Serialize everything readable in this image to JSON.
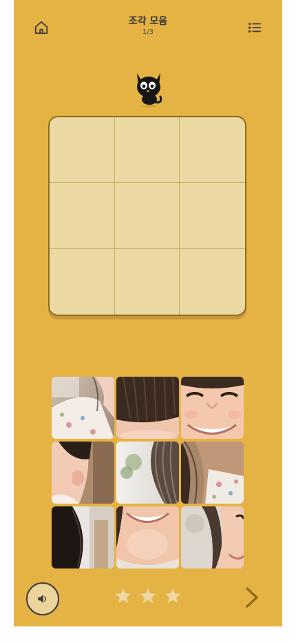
{
  "header": {
    "title": "조각 모음",
    "progress": "1/3"
  },
  "colors": {
    "background": "#e5b244",
    "board": "#ebd9a4",
    "board_border": "#8f6b1b",
    "star": "#edd9a3",
    "icon": "#3c3a3a"
  },
  "icons": {
    "home": "home-icon",
    "menu": "list-menu-icon",
    "sound": "speaker-icon",
    "next": "chevron-right-icon",
    "mascot": "black-cat-icon"
  },
  "board": {
    "rows": 3,
    "cols": 3,
    "filled": 0
  },
  "pieces": [
    {
      "name": "piece-cheek-flower-shirt"
    },
    {
      "name": "piece-bangs-forehead"
    },
    {
      "name": "piece-smiling-eyes"
    },
    {
      "name": "piece-ear-hair-left"
    },
    {
      "name": "piece-hair-blurred-background"
    },
    {
      "name": "piece-hair-flower-shirt"
    },
    {
      "name": "piece-dark-hair-edge"
    },
    {
      "name": "piece-smiling-chin"
    },
    {
      "name": "piece-face-right-blurred"
    }
  ],
  "rating": {
    "stars_total": 3,
    "stars_earned": 0
  }
}
